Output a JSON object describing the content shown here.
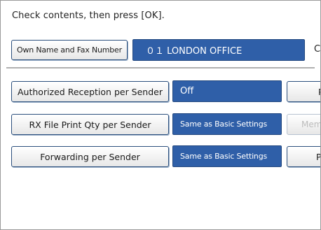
{
  "instruction": "Check contents, then press [OK].",
  "own_name": {
    "button_label": "Own Name and Fax Number",
    "value": "０１ LONDON OFFICE",
    "right_cut_label": "Co"
  },
  "settings": [
    {
      "button_label": "Authorized Reception per Sender",
      "value": "Off",
      "right_button_label": "Pri"
    },
    {
      "button_label": "RX File Print Qty per Sender",
      "value": "Same as Basic Settings",
      "right_button_label": "Mem"
    },
    {
      "button_label": "Forwarding per Sender",
      "value": "Same as Basic Settings",
      "right_button_label": "Pa"
    }
  ],
  "colors": {
    "field_blue": "#2f5fa8",
    "border_blue": "#2b4f7d"
  }
}
